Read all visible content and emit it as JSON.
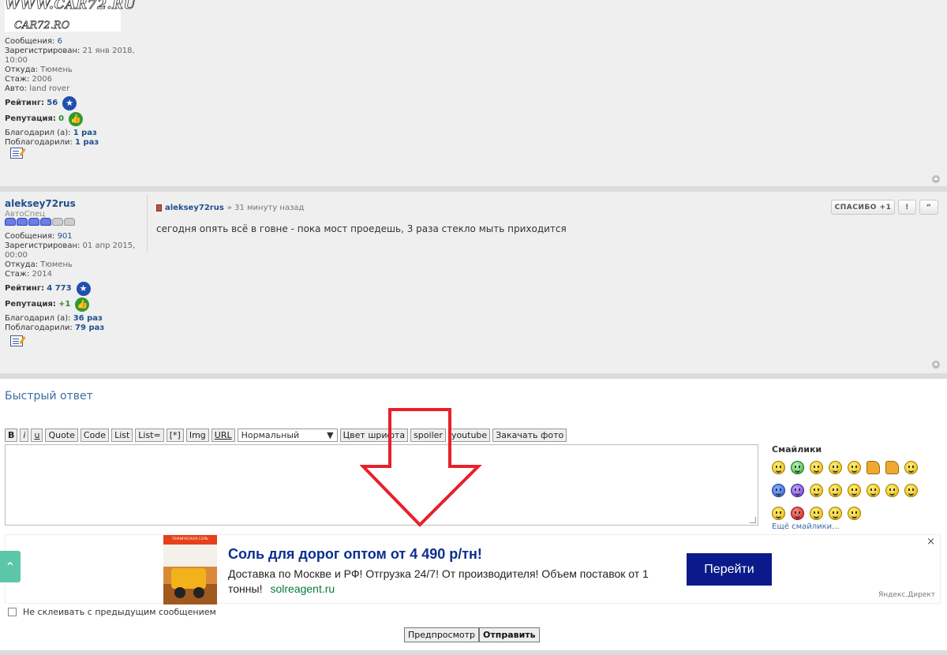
{
  "logo": {
    "text_top": "WWW.CAR72.RU",
    "text_bottom": "CAR72.RO"
  },
  "post1": {
    "profile": {
      "messages_label": "Сообщения:",
      "messages": "6",
      "registered_label": "Зарегистрирован:",
      "registered": "21 янв 2018,",
      "registered_time": "10:00",
      "from_label": "Откуда:",
      "from": "Тюмень",
      "exp_label": "Стаж:",
      "exp": "2006",
      "car_label": "Авто:",
      "car": "land rover",
      "rating_label": "Рейтинг:",
      "rating": "56",
      "rep_label": "Репутация:",
      "rep": "0",
      "thanked_label": "Благодарил (а):",
      "thanked": "1 раз",
      "got_thanks_label": "Поблагодарили:",
      "got_thanks": "1 раз"
    }
  },
  "post2": {
    "username": "aleksey72rus",
    "rank": "АвтоСпец",
    "profile": {
      "messages_label": "Сообщения:",
      "messages": "901",
      "registered_label": "Зарегистрирован:",
      "registered": "01 апр 2015,",
      "registered_time": "00:00",
      "from_label": "Откуда:",
      "from": "Тюмень",
      "exp_label": "Стаж:",
      "exp": "2014",
      "rating_label": "Рейтинг:",
      "rating": "4 773",
      "rep_label": "Репутация:",
      "rep": "+1",
      "thanked_label": "Благодарил (а):",
      "thanked": "36 раз",
      "got_thanks_label": "Поблагодарили:",
      "got_thanks": "79 раз"
    },
    "author": "aleksey72rus",
    "time": "» 31 минуту назад",
    "text": "сегодня опять всё в говне - пока мост проедешь, 3 раза стекло мыть приходится",
    "thanks_btn": "СПАСИБО +1",
    "report_btn": "!",
    "quote_btn": "“"
  },
  "quick_reply": {
    "title": "Быстрый ответ",
    "toolbar": [
      "B",
      "i",
      "u",
      "Quote",
      "Code",
      "List",
      "List=",
      "[*]",
      "Img",
      "URL"
    ],
    "font_size_select": "Нормальный",
    "toolbar2": [
      "Цвет шрифта",
      "spoiler",
      "youtube",
      "Закачать фото"
    ],
    "smilies_title": "Смайлики",
    "more_smilies": "Ещё смайлики...",
    "no_merge_label": "Не склеивать с предыдущим сообщением",
    "preview_btn": "Предпросмотр",
    "submit_btn": "Отправить"
  },
  "ad": {
    "image_label": "ТЕХНИЧЕСКАЯ СОЛЬ",
    "title": "Соль для дорог оптом от 4 490 р/тн!",
    "desc": "Доставка по Москве и РФ! Отгрузка 24/7! От производителя! Объем поставок от 1 тонны!",
    "url": "solreagent.ru",
    "button": "Перейти",
    "close": "×",
    "source": "Яндекс.Директ"
  },
  "colors": {
    "arrow": "#e8202a",
    "ad_button": "#0b1a8a",
    "link": "#1f4f8f"
  }
}
